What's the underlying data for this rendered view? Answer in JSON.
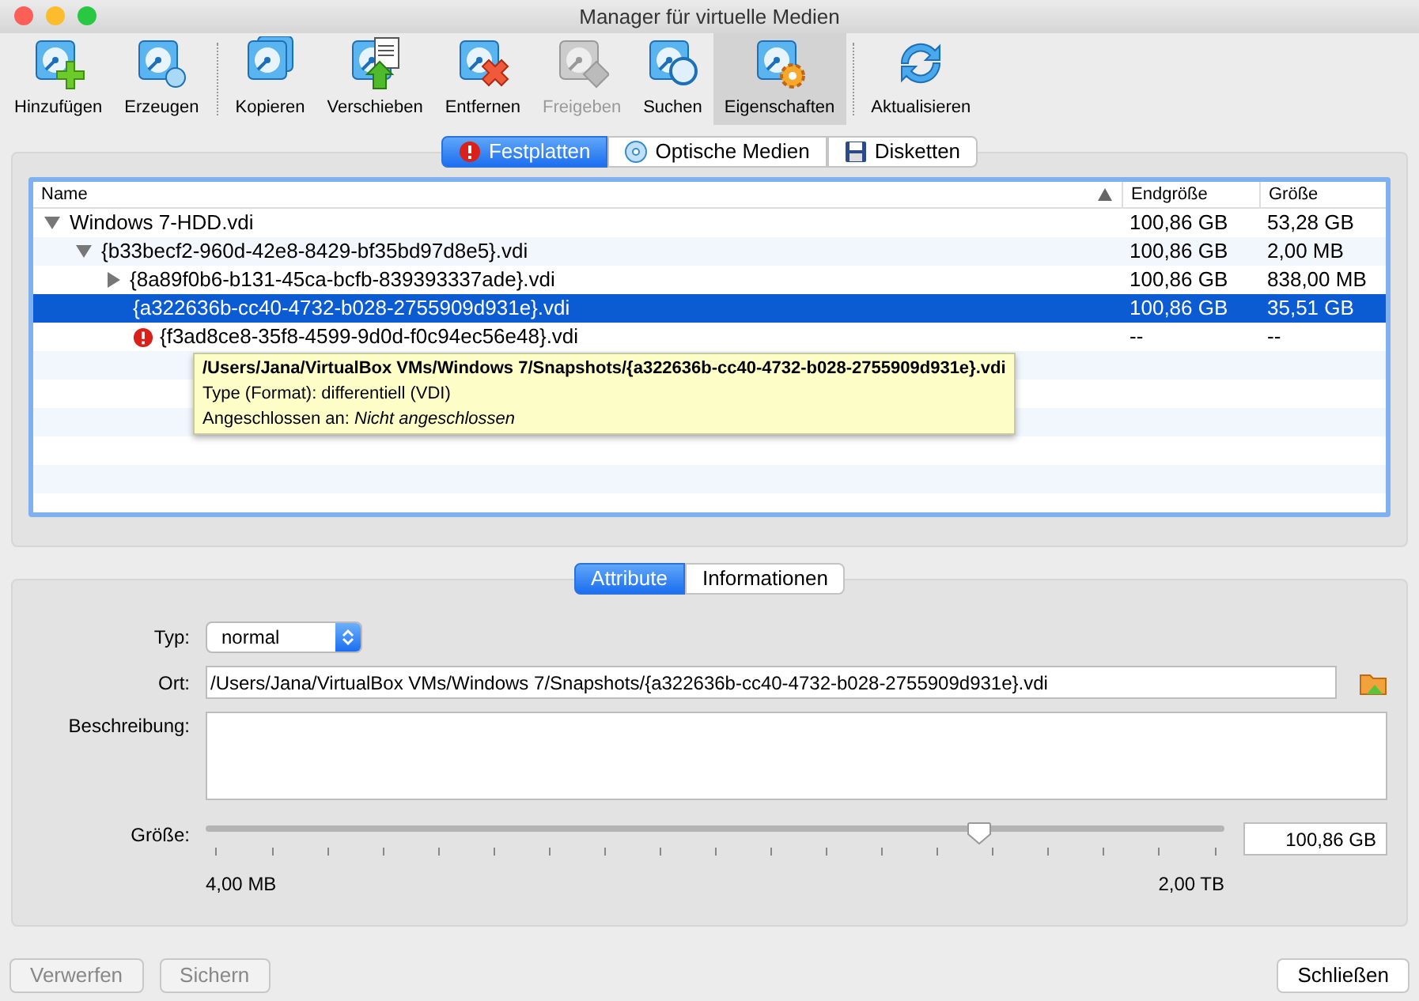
{
  "window": {
    "title": "Manager für virtuelle Medien"
  },
  "toolbar": {
    "groups": [
      [
        {
          "label": "Hinzufügen",
          "kind": "add",
          "disabled": false,
          "selected": false
        },
        {
          "label": "Erzeugen",
          "kind": "create",
          "disabled": false,
          "selected": false
        }
      ],
      [
        {
          "label": "Kopieren",
          "kind": "copy",
          "disabled": false,
          "selected": false
        },
        {
          "label": "Verschieben",
          "kind": "move",
          "disabled": false,
          "selected": false
        },
        {
          "label": "Entfernen",
          "kind": "remove",
          "disabled": false,
          "selected": false
        },
        {
          "label": "Freigeben",
          "kind": "release",
          "disabled": true,
          "selected": false
        },
        {
          "label": "Suchen",
          "kind": "search",
          "disabled": false,
          "selected": false
        },
        {
          "label": "Eigenschaften",
          "kind": "properties",
          "disabled": false,
          "selected": true
        }
      ],
      [
        {
          "label": "Aktualisieren",
          "kind": "refresh",
          "disabled": false,
          "selected": false
        }
      ]
    ]
  },
  "media_tabs": [
    {
      "label": "Festplatten",
      "kind": "hdd",
      "selected": true
    },
    {
      "label": "Optische Medien",
      "kind": "optical",
      "selected": false
    },
    {
      "label": "Disketten",
      "kind": "floppy",
      "selected": false
    }
  ],
  "table": {
    "columns": [
      "Name",
      "Endgröße",
      "Größe"
    ],
    "rows": [
      {
        "name": "Windows 7-HDD.vdi",
        "virtual_size": "100,86 GB",
        "actual_size": "53,28 GB",
        "expanded": true,
        "selected": false,
        "error": false,
        "children": [
          {
            "name": "{b33becf2-960d-42e8-8429-bf35bd97d8e5}.vdi",
            "virtual_size": "100,86 GB",
            "actual_size": "2,00 MB",
            "expanded": true,
            "selected": false,
            "error": false,
            "children": [
              {
                "name": "{8a89f0b6-b131-45ca-bcfb-839393337ade}.vdi",
                "virtual_size": "100,86 GB",
                "actual_size": "838,00 MB",
                "expanded": false,
                "selected": false,
                "error": false
              },
              {
                "name": "{a322636b-cc40-4732-b028-2755909d931e}.vdi",
                "virtual_size": "100,86 GB",
                "actual_size": "35,51 GB",
                "selected": true,
                "error": false
              },
              {
                "name": "{f3ad8ce8-35f8-4599-9d0d-f0c94ec56e48}.vdi",
                "virtual_size": "--",
                "actual_size": "--",
                "selected": false,
                "error": true
              }
            ]
          }
        ]
      }
    ]
  },
  "tooltip": {
    "lines": [
      "**/Users/Jana/VirtualBox VMs/Windows 7/Snapshots/{a322636b-cc40-4732-b028-2755909d931e}.vdi**",
      "Type (Format):  differentiell (VDI)",
      "Angeschlossen an: *Nicht angeschlossen*"
    ]
  },
  "detail_tabs": [
    {
      "label": "Attribute",
      "selected": true
    },
    {
      "label": "Informationen",
      "selected": false
    }
  ],
  "attributes": {
    "type_label": "Typ:",
    "type_value": "normal",
    "location_label": "Ort:",
    "location_value": "/Users/Jana/VirtualBox VMs/Windows 7/Snapshots/{a322636b-cc40-4732-b028-2755909d931e}.vdi",
    "description_label": "Beschreibung:",
    "size_label": "Größe:",
    "size_slider": {
      "level": 0.76,
      "min_label": "4,00 MB",
      "max_label": "2,00 TB"
    },
    "size_value": "100,86 GB"
  },
  "buttons": [
    {
      "label": "Verwerfen",
      "disabled": true
    },
    {
      "label": "Sichern",
      "disabled": true
    },
    {
      "label": "Schließen",
      "disabled": false
    }
  ]
}
